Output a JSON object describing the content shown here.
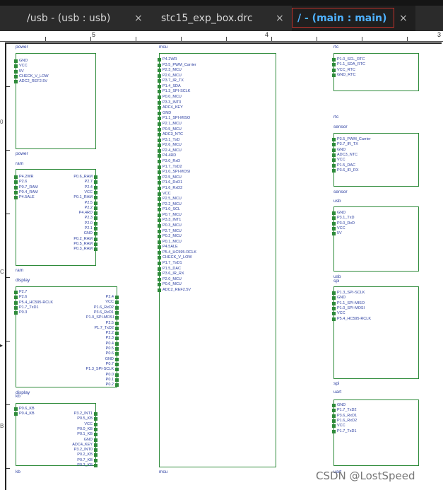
{
  "tabs": [
    {
      "label": "/usb - (usb : usb)",
      "active": false
    },
    {
      "label": "stc15_exp_box.drc",
      "active": false
    },
    {
      "label": "/ - (main : main)",
      "active": true
    }
  ],
  "close_glyph": "×",
  "ruler": [
    "5",
    "4",
    "3"
  ],
  "left_ruler": [
    "0",
    "C",
    "B"
  ],
  "watermark": "CSDN @LostSpeed",
  "colors": {
    "accent": "#4fb2ff",
    "block_border": "#2e8b3a",
    "pin_text": "#2b3ea0",
    "active_frame": "#c0312b"
  },
  "blocks": [
    {
      "name": "power",
      "top_label": "power",
      "bottom_label": "power",
      "left": [
        "GND",
        "VCC",
        "5V",
        "CHECK_V_LOW",
        "ADC2_REF2.5V"
      ],
      "right": []
    },
    {
      "name": "ram",
      "top_label": "ram",
      "bottom_label": "ram",
      "left": [
        "P4.2WR",
        "P2.6",
        "P0.7_RAM",
        "P0.4_RAM",
        "P4.5ALE"
      ],
      "right": [
        "P0.6_RAM",
        "P2.7",
        "P2.4",
        "VCC",
        "P0.1_RAM",
        "P2.5",
        "P2.2",
        "P4.4RD",
        "P2.3",
        "P2.0",
        "P2.1",
        "GND",
        "P0.2_RAM",
        "P0.5_RAM",
        "P0.3_RAM"
      ]
    },
    {
      "name": "display",
      "top_label": "display",
      "bottom_label": "display",
      "left": [
        "P2.7",
        "P2.6",
        "P5.4_HC595-RCLK",
        "P1.7_TxD1",
        "P0.3"
      ],
      "right": [
        "P2.4",
        "VCC",
        "P1.6_RxD2",
        "P3.6_RxD1",
        "P1.0_SPI-MOSI",
        "P2.5",
        "P1.7_TxD2",
        "P2.2",
        "P2.3",
        "P0.4",
        "P0.5",
        "P0.6",
        "GND",
        "P0.7",
        "P1.3_SPI-SCLK",
        "P0.0",
        "P0.1",
        "P0.2"
      ]
    },
    {
      "name": "kb",
      "top_label": "kb",
      "bottom_label": "kb",
      "left": [
        "P0.6_KB",
        "P0.4_KB"
      ],
      "right": [
        "P3.2_INT1",
        "P0.5_KB",
        "VCC",
        "P0.0_KB",
        "P0.1_KB",
        "GND",
        "ADC4_KEY",
        "P3.2_INT0",
        "P0.2_KB",
        "P0.7_KB",
        "P0.3_KB"
      ]
    },
    {
      "name": "mcu",
      "top_label": "mcu",
      "bottom_label": "mcu",
      "left": [
        "P4.2WR",
        "P3.5_PWM_Carrier",
        "P2.3_MCU",
        "P2.0_MCU",
        "P3.7_IR_TX",
        "P1.4_SDA",
        "P1.3_SPI-SCLK",
        "P0.0_MCU",
        "P3.3_INT0",
        "ADC4_KEY",
        "GND",
        "P1.1_SPI-MISO",
        "P2.1_MCU",
        "P0.5_MCU",
        "ADC3_NTC",
        "P3.1_TxD",
        "P2.6_MCU",
        "P2.4_MCU",
        "P4.4RD",
        "P3.0_RxD",
        "P1.7_TxD2",
        "P1.0_SPI-MOSI",
        "P2.5_MCU",
        "P1.6_RxD1",
        "P1.6_RxD2",
        "VCC",
        "P2.5_MCU",
        "P2.2_MCU",
        "P1.0_SCL",
        "P0.7_MCU",
        "P3.3_INT1",
        "P0.3_MCU",
        "P2.7_MCU",
        "P0.2_MCU",
        "P0.1_MCU",
        "P4.5ALE",
        "P5.4_HC595-RCLK",
        "CHECK_V_LOW",
        "P1.7_TxD1",
        "P1.5_DAC",
        "P3.6_IR_RX",
        "P2.0_MCU",
        "P0.6_MCU",
        "ADC2_REF2.5V"
      ],
      "right": []
    },
    {
      "name": "rtc",
      "top_label": "rtc",
      "bottom_label": "rtc",
      "left": [
        "P1.0_SCL_RTC",
        "P1.1_SDA_RTC",
        "VCC_RTC",
        "GND_RTC"
      ],
      "right": []
    },
    {
      "name": "sensor",
      "top_label": "sensor",
      "bottom_label": "sensor",
      "left": [
        "P3.5_PWM_Carrier",
        "P3.7_IR_TX",
        "GND",
        "ADC3_NTC",
        "VCC",
        "P1.5_DAC",
        "P3.6_IR_RX"
      ],
      "right": []
    },
    {
      "name": "usb",
      "top_label": "usb",
      "bottom_label": "usb",
      "left": [
        "GND",
        "P3.1_TxD",
        "P3.0_RxD",
        "VCC",
        "5V"
      ],
      "right": []
    },
    {
      "name": "spi",
      "top_label": "spi",
      "bottom_label": "spi",
      "left": [
        "P1.3_SPI-SCLK",
        "GND",
        "P1.1_SPI-MISO",
        "P1.0_SPI-MOSI",
        "VCC",
        "P5.4_HC595-RCLK"
      ],
      "right": []
    },
    {
      "name": "uart",
      "top_label": "uart",
      "bottom_label": "uart",
      "left": [
        "GND",
        "P1.7_TxD2",
        "P3.6_RxD1",
        "P1.6_RxD2",
        "VCC",
        "P1.7_TxD1"
      ],
      "right": []
    }
  ]
}
